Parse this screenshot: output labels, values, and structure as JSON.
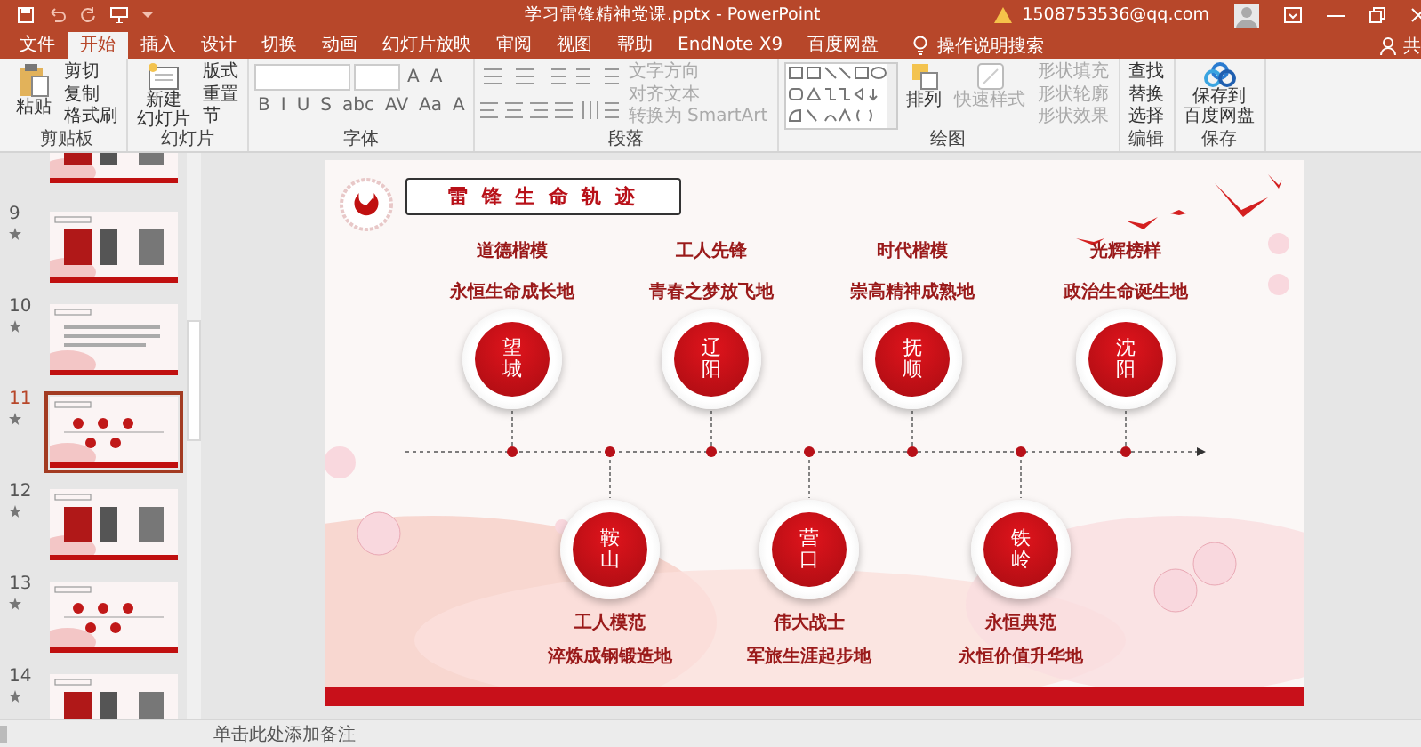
{
  "window": {
    "title": "学习雷锋精神党课.pptx - PowerPoint",
    "account": "1508753536@qq.com"
  },
  "tabs": [
    {
      "label": "文件",
      "selected": false
    },
    {
      "label": "开始",
      "selected": true
    },
    {
      "label": "插入",
      "selected": false
    },
    {
      "label": "设计",
      "selected": false
    },
    {
      "label": "切换",
      "selected": false
    },
    {
      "label": "动画",
      "selected": false
    },
    {
      "label": "幻灯片放映",
      "selected": false
    },
    {
      "label": "审阅",
      "selected": false
    },
    {
      "label": "视图",
      "selected": false
    },
    {
      "label": "帮助",
      "selected": false
    },
    {
      "label": "EndNote X9",
      "selected": false
    },
    {
      "label": "百度网盘",
      "selected": false
    }
  ],
  "search": {
    "placeholder": "操作说明搜索"
  },
  "share": {
    "label": "共"
  },
  "ribbon": [
    {
      "kind": "clipboard",
      "label": "剪贴板",
      "big": "粘贴",
      "items": [
        {
          "label": "剪切",
          "disabled": false
        },
        {
          "label": "复制",
          "disabled": false
        },
        {
          "label": "格式刷",
          "disabled": false
        }
      ]
    },
    {
      "kind": "slides",
      "label": "幻灯片",
      "big": "新建",
      "big2": "幻灯片",
      "items": [
        {
          "label": "版式",
          "disabled": false
        },
        {
          "label": "重置",
          "disabled": false
        },
        {
          "label": "节",
          "disabled": false
        }
      ]
    },
    {
      "kind": "font",
      "label": "字体",
      "row1": [
        "A",
        "A"
      ],
      "row2": [
        "B",
        "I",
        "U",
        "S",
        "abc",
        "AV",
        "Aa",
        "A"
      ]
    },
    {
      "kind": "paragraph",
      "label": "段落",
      "items": [
        {
          "label": "文字方向",
          "disabled": true
        },
        {
          "label": "对齐文本",
          "disabled": true
        },
        {
          "label": "转换为 SmartArt",
          "disabled": true
        }
      ]
    },
    {
      "kind": "drawing",
      "label": "绘图",
      "big": "排列",
      "big2": "快速样式",
      "items": [
        {
          "label": "形状填充",
          "disabled": true
        },
        {
          "label": "形状轮廓",
          "disabled": true
        },
        {
          "label": "形状效果",
          "disabled": true
        }
      ]
    },
    {
      "kind": "editing",
      "label": "编辑",
      "items": [
        {
          "label": "查找",
          "disabled": false
        },
        {
          "label": "替换",
          "disabled": false
        },
        {
          "label": "选择",
          "disabled": false
        }
      ]
    },
    {
      "kind": "save",
      "label": "保存",
      "big": "保存到",
      "big2": "百度网盘"
    }
  ],
  "thumbnails": [
    {
      "kind": "partial",
      "selected": false
    },
    {
      "number": "9",
      "starred": true,
      "selected": false
    },
    {
      "number": "10",
      "starred": true,
      "selected": false
    },
    {
      "number": "11",
      "starred": true,
      "selected": true
    },
    {
      "number": "12",
      "starred": true,
      "selected": false
    },
    {
      "number": "13",
      "starred": true,
      "selected": false
    },
    {
      "number": "14",
      "starred": true,
      "selected": false
    }
  ],
  "slide": {
    "title": "雷 锋 生 命 轨 迹",
    "top": [
      {
        "place": "望城",
        "title": "道德楷模",
        "subtitle": "永恒生命成长地"
      },
      {
        "place": "辽阳",
        "title": "工人先锋",
        "subtitle": "青春之梦放飞地"
      },
      {
        "place": "抚顺",
        "title": "时代楷模",
        "subtitle": "崇高精神成熟地"
      },
      {
        "place": "沈阳",
        "title": "光辉榜样",
        "subtitle": "政治生命诞生地"
      }
    ],
    "bottom": [
      {
        "place": "鞍山",
        "title": "工人模范",
        "subtitle": "淬炼成钢锻造地"
      },
      {
        "place": "营口",
        "title": "伟大战士",
        "subtitle": "军旅生涯起步地"
      },
      {
        "place": "铁岭",
        "title": "永恒典范",
        "subtitle": "永恒价值升华地"
      }
    ]
  },
  "notes": {
    "placeholder": "单击此处添加备注"
  }
}
